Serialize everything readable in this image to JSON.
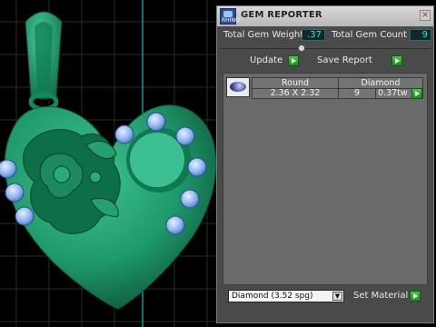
{
  "panel": {
    "title": "GEM REPORTER",
    "app_icon_label": "RHINO",
    "close_glyph": "×",
    "close_icon": "close-icon"
  },
  "stats": {
    "weight_label": "Total Gem Weight",
    "weight_value": ".37",
    "count_label": "Total Gem Count",
    "count_value": "9"
  },
  "actions": {
    "update_label": "Update",
    "save_label": "Save Report"
  },
  "gem_table": {
    "headers": [
      "Round",
      "Diamond"
    ],
    "rows": [
      {
        "thumbnail": "round-gem-icon",
        "size": "2.36 X 2.32",
        "count": "9",
        "weight": "0.37tw"
      }
    ]
  },
  "material": {
    "selected": "Diamond    (3.52 spg)",
    "set_label": "Set Material"
  },
  "colors": {
    "pendant_green": "#1f9a6a",
    "gem_blue": "#8fb4f0",
    "value_cyan": "#35e0e0",
    "button_green": "#2fb82f",
    "grid_cyan": "#17b8c8",
    "axis_red": "#d02020"
  }
}
